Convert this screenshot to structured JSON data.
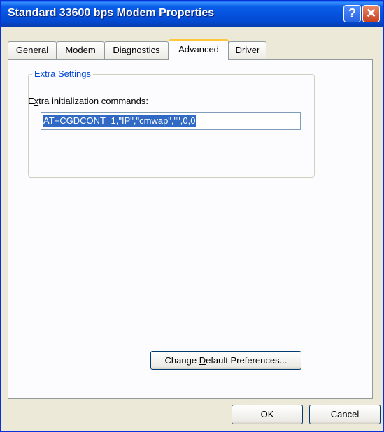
{
  "window": {
    "title": "Standard 33600 bps Modem Properties",
    "help_glyph": "?",
    "close_glyph": "✕"
  },
  "tabs": [
    {
      "label": "General",
      "active": false
    },
    {
      "label": "Modem",
      "active": false
    },
    {
      "label": "Diagnostics",
      "active": false
    },
    {
      "label": "Advanced",
      "active": true
    },
    {
      "label": "Driver",
      "active": false
    }
  ],
  "extra_settings": {
    "group_label": "Extra Settings",
    "field_label_pre": "E",
    "field_label_ul": "x",
    "field_label_post": "tra initialization commands:",
    "value": "AT+CGDCONT=1,\"IP\",\"cmwap\",\"\",0,0"
  },
  "change_prefs": {
    "pre": "Change ",
    "ul": "D",
    "post": "efault Preferences..."
  },
  "buttons": {
    "ok": "OK",
    "cancel": "Cancel"
  },
  "colors": {
    "titlebar": "#0553de",
    "selection": "#316ac5",
    "active_tab_accent": "#ffc83c"
  }
}
